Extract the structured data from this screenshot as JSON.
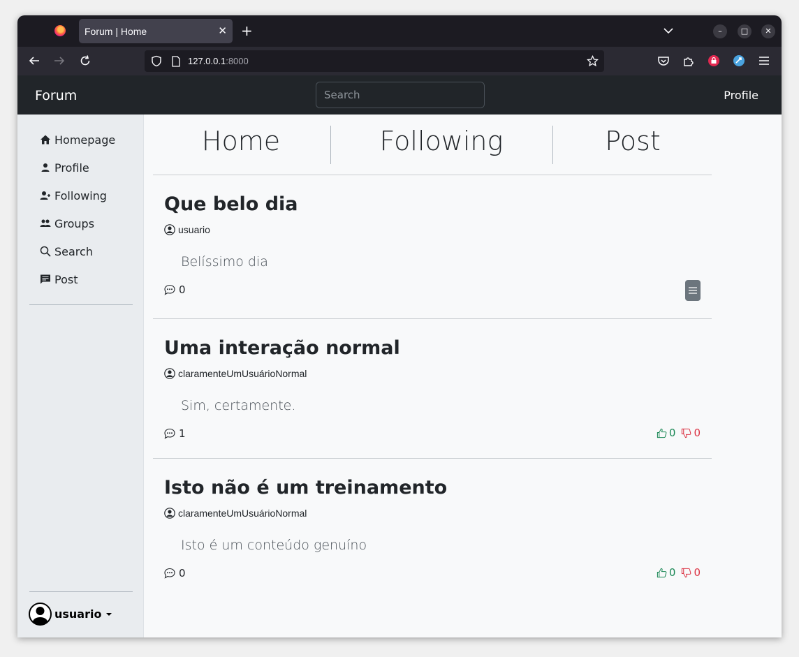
{
  "browser": {
    "tab_title": "Forum | Home",
    "url_host": "127.0.0.1",
    "url_port": ":8000"
  },
  "navbar": {
    "brand": "Forum",
    "search_placeholder": "Search",
    "profile_link": "Profile"
  },
  "sidebar": {
    "items": [
      {
        "label": "Homepage",
        "icon": "house-icon"
      },
      {
        "label": "Profile",
        "icon": "person-icon"
      },
      {
        "label": "Following",
        "icon": "person-plus-icon"
      },
      {
        "label": "Groups",
        "icon": "people-icon"
      },
      {
        "label": "Search",
        "icon": "search-icon"
      },
      {
        "label": "Post",
        "icon": "chat-left-text-icon"
      }
    ],
    "user": "usuario"
  },
  "main_tabs": [
    "Home",
    "Following",
    "Post"
  ],
  "posts": [
    {
      "title": "Que belo dia",
      "author": "usuario",
      "body": "Belíssimo dia",
      "comments": "0",
      "own": true
    },
    {
      "title": "Uma interação normal",
      "author": "claramenteUmUsuárioNormal",
      "body": "Sim, certamente.",
      "comments": "1",
      "likes": "0",
      "dislikes": "0"
    },
    {
      "title": "Isto não é um treinamento",
      "author": "claramenteUmUsuárioNormal",
      "body": "Isto é um conteúdo genuíno",
      "comments": "0",
      "likes": "0",
      "dislikes": "0"
    }
  ],
  "colors": {
    "navbar_bg": "#212529",
    "sidebar_bg": "#e9ecef",
    "like": "#198754",
    "dislike": "#dc3545"
  }
}
